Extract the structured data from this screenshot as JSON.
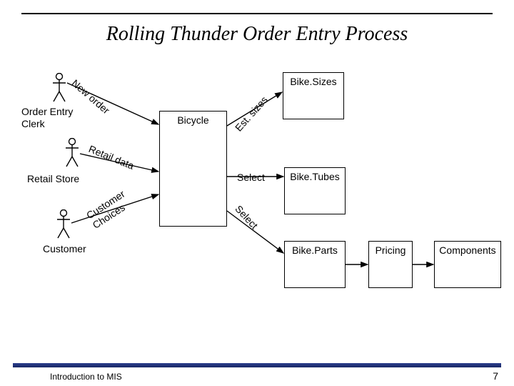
{
  "title": "Rolling Thunder Order Entry Process",
  "footer_left": "Introduction to MIS",
  "footer_right": "7",
  "actors": {
    "clerk": "Order Entry\nClerk",
    "retail": "Retail Store",
    "customer": "Customer"
  },
  "boxes": {
    "bicycle": "Bicycle",
    "sizes": "Bike.Sizes",
    "tubes": "Bike.Tubes",
    "parts": "Bike.Parts",
    "pricing": "Pricing",
    "components": "Components"
  },
  "edges": {
    "new_order": "New order",
    "retail_data": "Retail data",
    "customer_choices": "Customer\nChoices",
    "est_sizes": "Est. sizes",
    "select_tubes": "Select",
    "select_parts": "Select"
  }
}
